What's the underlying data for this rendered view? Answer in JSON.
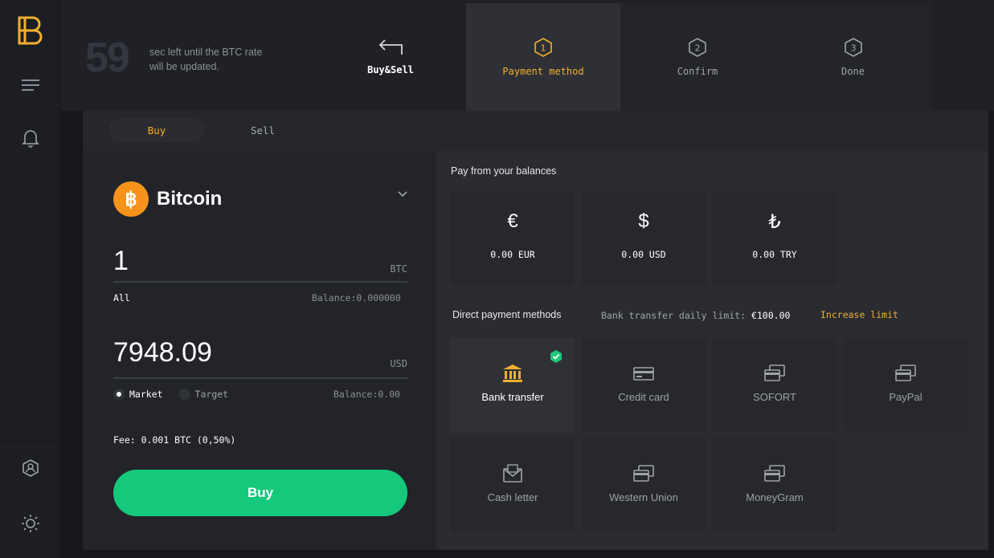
{
  "app": {
    "logo": "B"
  },
  "timer": {
    "seconds": "59",
    "text": "sec left until the BTC rate will be updated."
  },
  "steps": {
    "back": {
      "label": "Buy&Sell"
    },
    "payment": {
      "label": "Payment method",
      "number": "1"
    },
    "confirm": {
      "label": "Confirm",
      "number": "2"
    },
    "done": {
      "label": "Done",
      "number": "3"
    }
  },
  "tabs": {
    "buy": "Buy",
    "sell": "Sell"
  },
  "coin": {
    "name": "Bitcoin",
    "symbol": "฿"
  },
  "amount": {
    "value": "1",
    "unit": "BTC",
    "all_label": "All",
    "balance": "Balance:0.000000"
  },
  "total": {
    "value": "7948.09",
    "unit": "USD",
    "balance": "Balance:0.00"
  },
  "order_type": {
    "market": "Market",
    "target": "Target",
    "selected": "Market"
  },
  "fee": "Fee: 0.001 BTC (0,50%)",
  "buy_button": "Buy",
  "balances": {
    "title": "Pay from your balances",
    "items": [
      {
        "symbol": "€",
        "amount": "0.00 EUR"
      },
      {
        "symbol": "$",
        "amount": "0.00 USD"
      },
      {
        "symbol": "₺",
        "amount": "0.00 TRY"
      }
    ]
  },
  "direct": {
    "title": "Direct payment methods",
    "limit_label": "Bank transfer daily limit:",
    "limit_value": "€100.00",
    "increase": "Increase limit",
    "methods": [
      {
        "name": "Bank transfer",
        "icon": "bank-icon",
        "selected": true
      },
      {
        "name": "Credit card",
        "icon": "credit-card-icon"
      },
      {
        "name": "SOFORT",
        "icon": "payment-card-icon"
      },
      {
        "name": "PayPal",
        "icon": "payment-card-icon"
      },
      {
        "name": "Cash letter",
        "icon": "envelope-icon"
      },
      {
        "name": "Western Union",
        "icon": "payment-card-icon"
      },
      {
        "name": "MoneyGram",
        "icon": "payment-card-icon"
      }
    ]
  },
  "colors": {
    "accent": "#f3b02f",
    "buy_green": "#14c97b",
    "bitcoin": "#f7931a",
    "check_green": "#1fc77a"
  }
}
